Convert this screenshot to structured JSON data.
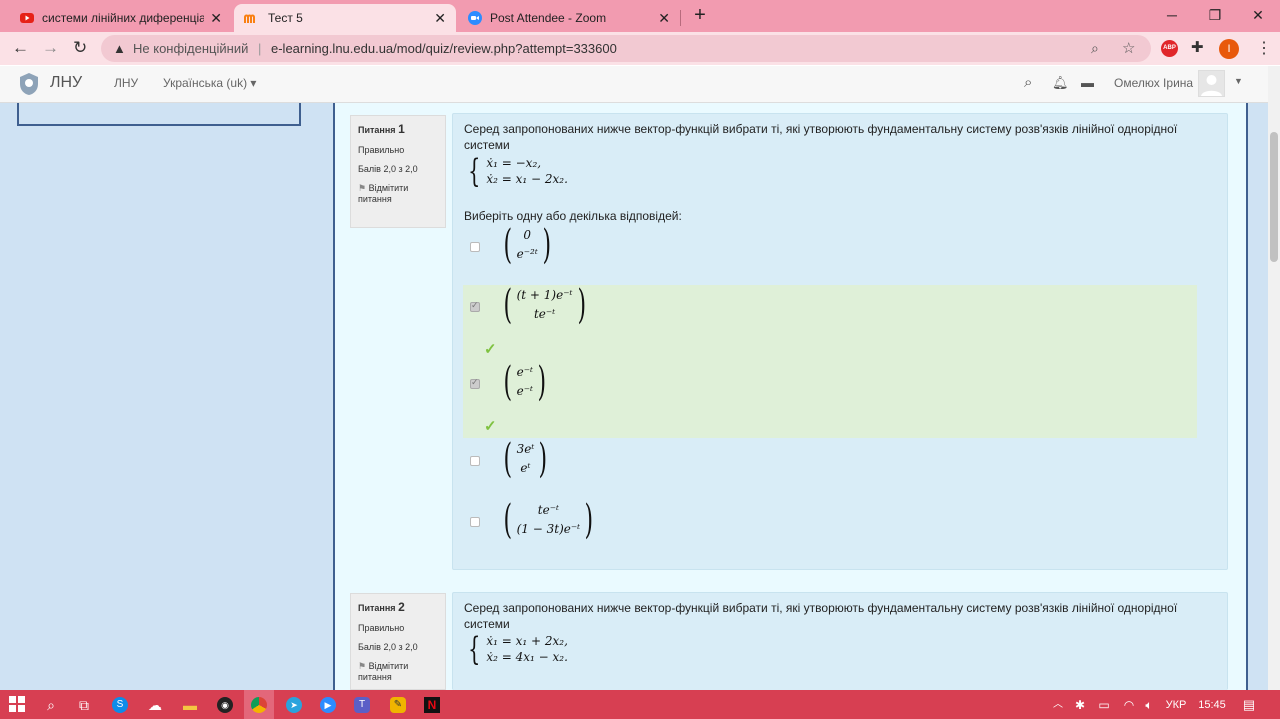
{
  "browser": {
    "tabs": [
      {
        "title": "системи лінійних диференціаль",
        "icon": "youtube-icon"
      },
      {
        "title": "Тест 5",
        "icon": "moodle-icon"
      },
      {
        "title": "Post Attendee - Zoom",
        "icon": "zoom-icon"
      }
    ],
    "new_tab": "+",
    "security_label": "Не конфіденційний",
    "url": "e-learning.lnu.edu.ua/mod/quiz/review.php?attempt=333600",
    "profile_initial": "I"
  },
  "moodle": {
    "site_name": "ЛНУ",
    "nav_link": "ЛНУ",
    "language": "Українська (uk) ▾",
    "user_name": "Омелюх Ірина"
  },
  "questions": [
    {
      "label": "Питання",
      "number": "1",
      "state": "Правильно",
      "grade": "Балів 2,0 з 2,0",
      "flag_label": "Відмітити питання",
      "text": "Серед запропонованих нижче вектор-функцій вибрати ті, які утворюють фундаментальну систему розв'язків лінійної однорідної системи",
      "system": [
        "ẋ₁ = −x₂,",
        "ẋ₂ = x₁ − 2x₂."
      ],
      "prompt": "Виберіть одну або декілька відповідей:",
      "options": [
        {
          "top": "0",
          "bottom": "e⁻²ᵗ",
          "checked": false,
          "correct": false
        },
        {
          "top": "(t + 1)e⁻ᵗ",
          "bottom": "te⁻ᵗ",
          "checked": true,
          "correct": true
        },
        {
          "top": "e⁻ᵗ",
          "bottom": "e⁻ᵗ",
          "checked": true,
          "correct": true
        },
        {
          "top": "3eᵗ",
          "bottom": "eᵗ",
          "checked": false,
          "correct": false
        },
        {
          "top": "te⁻ᵗ",
          "bottom": "(1 − 3t)e⁻ᵗ",
          "checked": false,
          "correct": false
        }
      ]
    },
    {
      "label": "Питання",
      "number": "2",
      "state": "Правильно",
      "grade": "Балів 2,0 з 2,0",
      "flag_label": "Відмітити питання",
      "text": "Серед запропонованих нижче вектор-функцій вибрати ті, які утворюють фундаментальну систему розв'язків лінійної однорідної системи",
      "system": [
        "ẋ₁ = x₁ + 2x₂,",
        "ẋ₂ = 4x₁ − x₂."
      ]
    }
  ],
  "taskbar": {
    "language": "УКР",
    "time": "15:45"
  },
  "colors": {
    "tab_strip": "#f29bb0",
    "taskbar": "#d73f52",
    "correct_bg": "#dff0d8",
    "content_bg": "#d9edf7"
  }
}
